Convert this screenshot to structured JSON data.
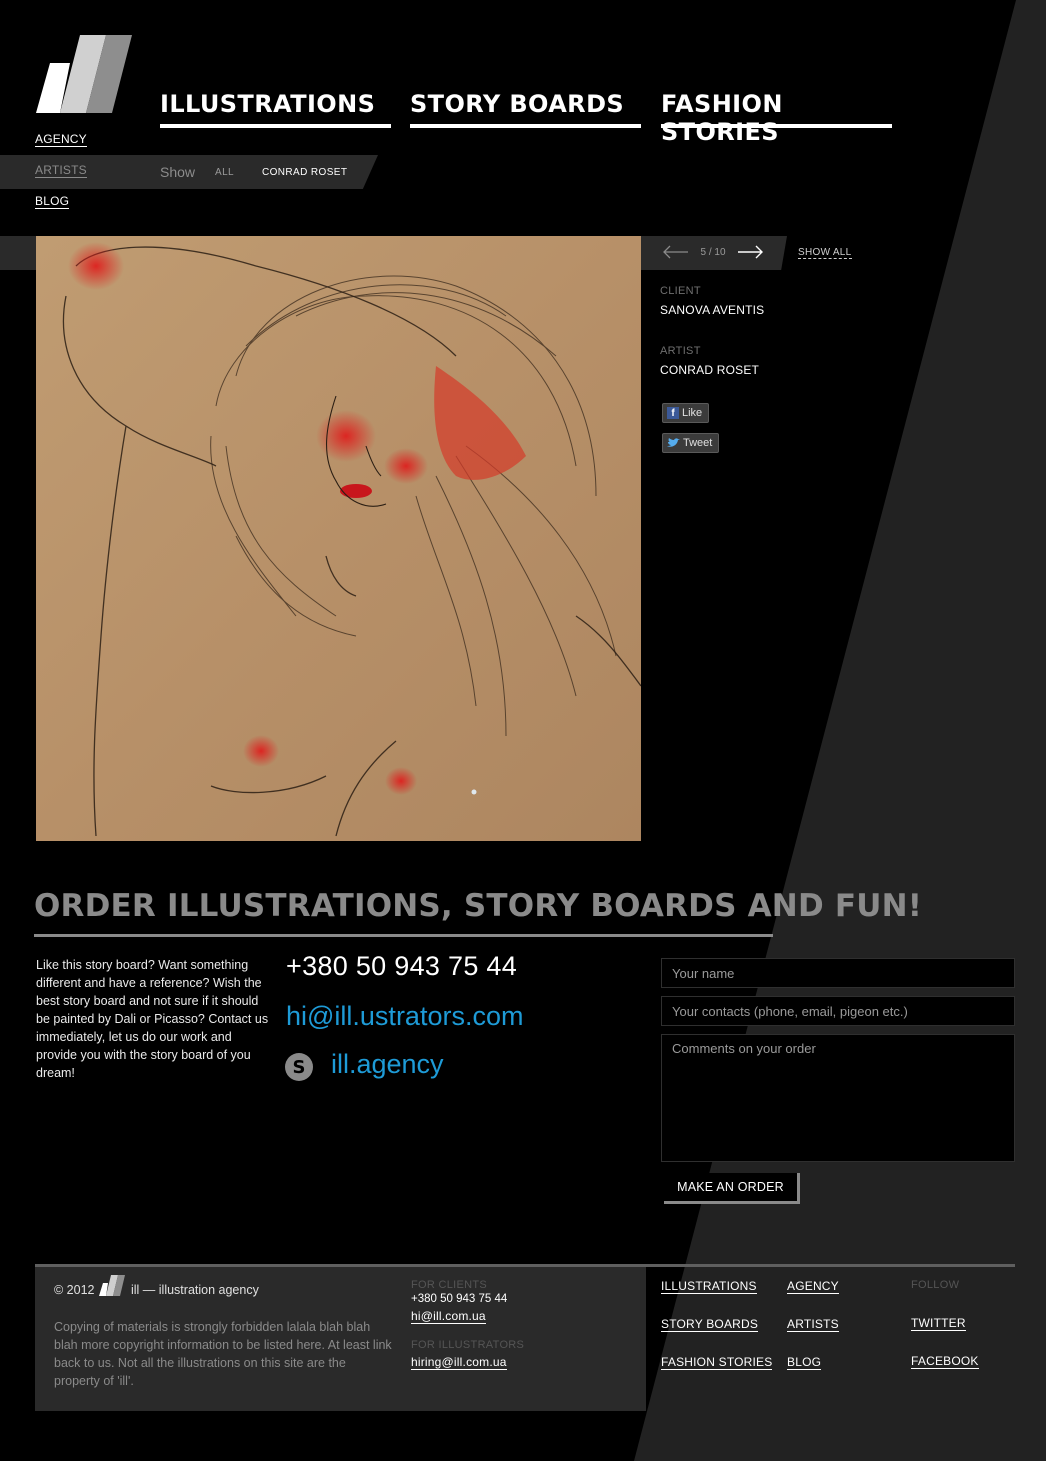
{
  "nav": {
    "left": [
      "AGENCY",
      "ARTISTS",
      "BLOG"
    ],
    "main": [
      "ILLUSTRATIONS",
      "STORY BOARDS",
      "FASHION STORIES"
    ]
  },
  "filter": {
    "show_label": "Show",
    "options": [
      "ALL",
      "CONRAD ROSET"
    ]
  },
  "viewer": {
    "counter": "5 / 10",
    "show_all": "SHOW ALL",
    "client_label": "CLIENT",
    "client_value": "SANOVA AVENTIS",
    "artist_label": "ARTIST",
    "artist_value": "CONRAD ROSET",
    "like_label": "Like",
    "tweet_label": "Tweet"
  },
  "order": {
    "title": "ORDER ILLUSTRATIONS, STORY BOARDS AND FUN!",
    "text": "Like this story board? Want something different and have a reference? Wish the best story board and not sure if it should be painted by Dali or Picasso? Contact us immediately, let us do our work and provide you with the story board of you dream!",
    "phone": "+380 50 943 75 44",
    "email": "hi@ill.ustrators.com",
    "skype": "ill.agency",
    "name_placeholder": "Your name",
    "contacts_placeholder": "Your contacts (phone, email, pigeon etc.)",
    "comments_placeholder": "Comments on your order",
    "submit_label": "MAKE AN ORDER"
  },
  "footer": {
    "year": "© 2012",
    "agency_name": "ill — illustration agency",
    "copyright": "Copying of materials is strongly forbidden lalala blah blah blah more copyright information to be listed here. At least link back to us. Not all the illustrations on this site are the property of 'ill'.",
    "for_clients_label": "FOR CLIENTS",
    "clients_phone": "+380 50 943 75 44",
    "clients_email": "hi@ill.com.ua",
    "for_illustrators_label": "FOR ILLUSTRATORS",
    "illustrators_email": "hiring@ill.com.ua",
    "links_col1": [
      "ILLUSTRATIONS",
      "STORY BOARDS",
      "FASHION STORIES"
    ],
    "links_col2": [
      "AGENCY",
      "ARTISTS",
      "BLOG"
    ],
    "follow_label": "FOLLOW",
    "follow_links": [
      "TWITTER",
      "FACEBOOK"
    ]
  },
  "colors": {
    "background": "#000000",
    "stripe": "#222222",
    "band": "#2a2a2a",
    "link_blue": "#1e9bd7",
    "muted_gray": "#8a8a8a"
  },
  "icons": [
    "logo-icon",
    "prev-arrow-icon",
    "next-arrow-icon",
    "facebook-icon",
    "twitter-bird-icon",
    "skype-icon"
  ]
}
